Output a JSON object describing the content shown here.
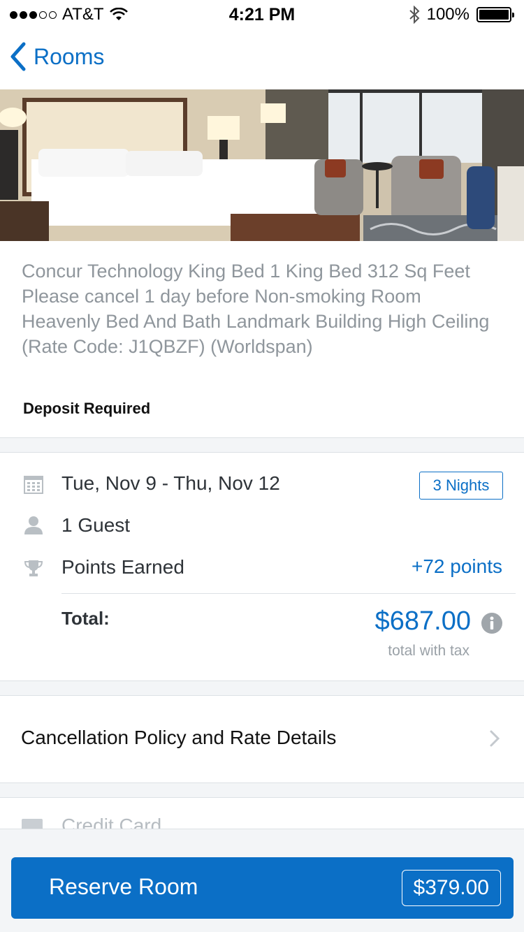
{
  "status_bar": {
    "carrier": "AT&T",
    "time": "4:21 PM",
    "battery": "100%"
  },
  "nav": {
    "back_label": "Rooms"
  },
  "room": {
    "description": "Concur Technology King Bed 1 King Bed 312 Sq Feet Please cancel 1 day before Non-smoking Room Heavenly Bed And Bath Landmark Building High Ceiling (Rate Code: J1QBZF)  (Worldspan)",
    "deposit": "Deposit Required"
  },
  "details": {
    "dates": "Tue, Nov 9 - Thu, Nov 12",
    "nights": "3 Nights",
    "guests": "1 Guest",
    "points_label": "Points Earned",
    "points_value": "+72 points",
    "total_label": "Total:",
    "total_value": "$687.00",
    "total_sub": "total with tax"
  },
  "cancellation": {
    "label": "Cancellation Policy and Rate Details"
  },
  "payment": {
    "credit_label": "Credit Card"
  },
  "footer": {
    "reserve_label": "Reserve Room",
    "reserve_price": "$379.00"
  },
  "colors": {
    "accent": "#0b6fc6",
    "muted_text": "#8f969c",
    "band": "#f3f5f7"
  }
}
